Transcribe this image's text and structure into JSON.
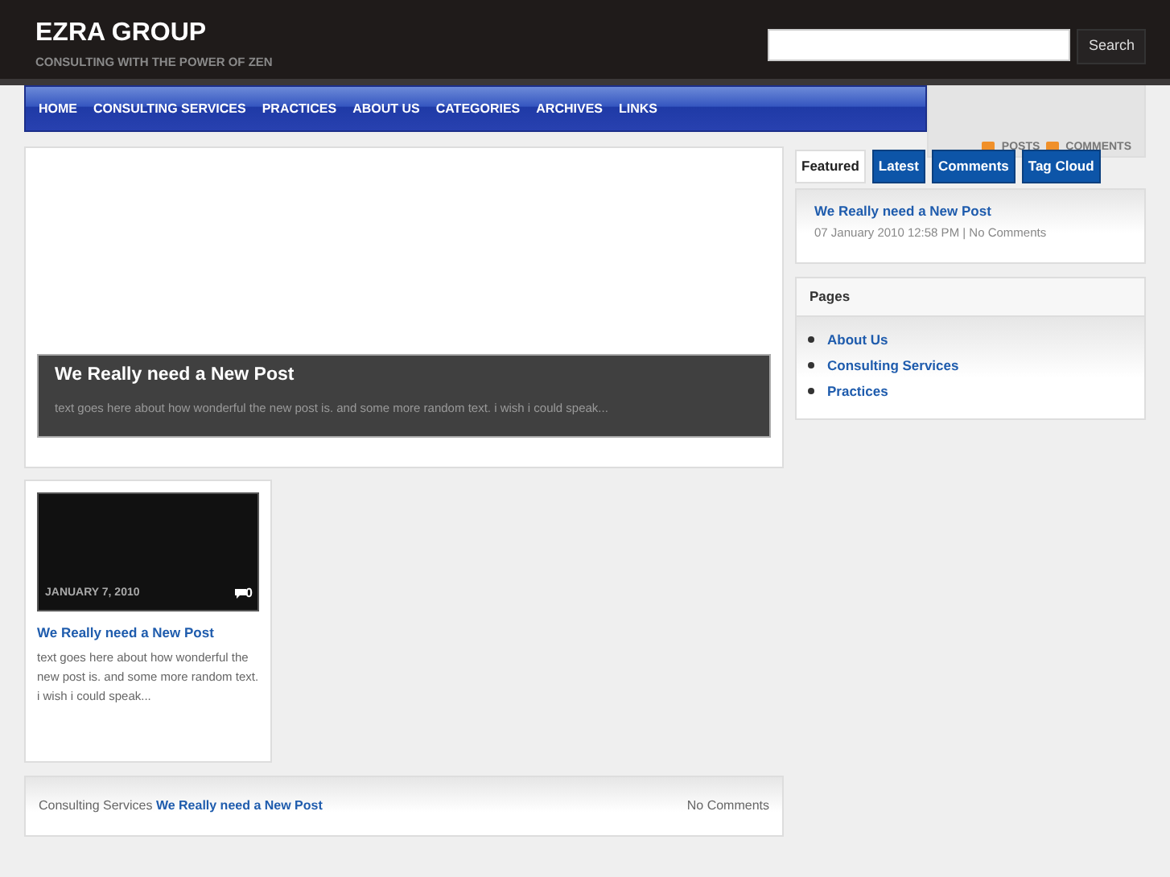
{
  "site": {
    "title": "EZRA GROUP",
    "tagline": "CONSULTING WITH THE POWER OF ZEN"
  },
  "search": {
    "button": "Search"
  },
  "nav": [
    "HOME",
    "CONSULTING SERVICES",
    "PRACTICES",
    "ABOUT US",
    "CATEGORIES",
    "ARCHIVES",
    "LINKS"
  ],
  "feeds": [
    "POSTS",
    "COMMENTS"
  ],
  "featured": {
    "title": "We Really need a New Post",
    "excerpt": "text goes here about how wonderful the new post is. and some more random text. i wish i could speak..."
  },
  "posts": [
    {
      "date": "JANUARY 7, 2010",
      "comments": "0",
      "title": "We Really need a New Post",
      "excerpt": "text goes here about how wonderful the new post is. and some more random text. i wish i could speak..."
    }
  ],
  "footer_post": {
    "category": "Consulting Services",
    "title": "We Really need a New Post",
    "comments": "No Comments"
  },
  "sidebar": {
    "tabs": [
      {
        "label": "Featured",
        "selected": true
      },
      {
        "label": "Latest",
        "selected": false
      },
      {
        "label": "Comments",
        "selected": false
      },
      {
        "label": "Tag Cloud",
        "selected": false
      }
    ],
    "tab_post": {
      "title": "We Really need a New Post",
      "meta": "07 January 2010 12:58 PM | No Comments"
    },
    "pages": {
      "title": "Pages",
      "items": [
        "About Us",
        "Consulting Services",
        "Practices"
      ]
    }
  }
}
